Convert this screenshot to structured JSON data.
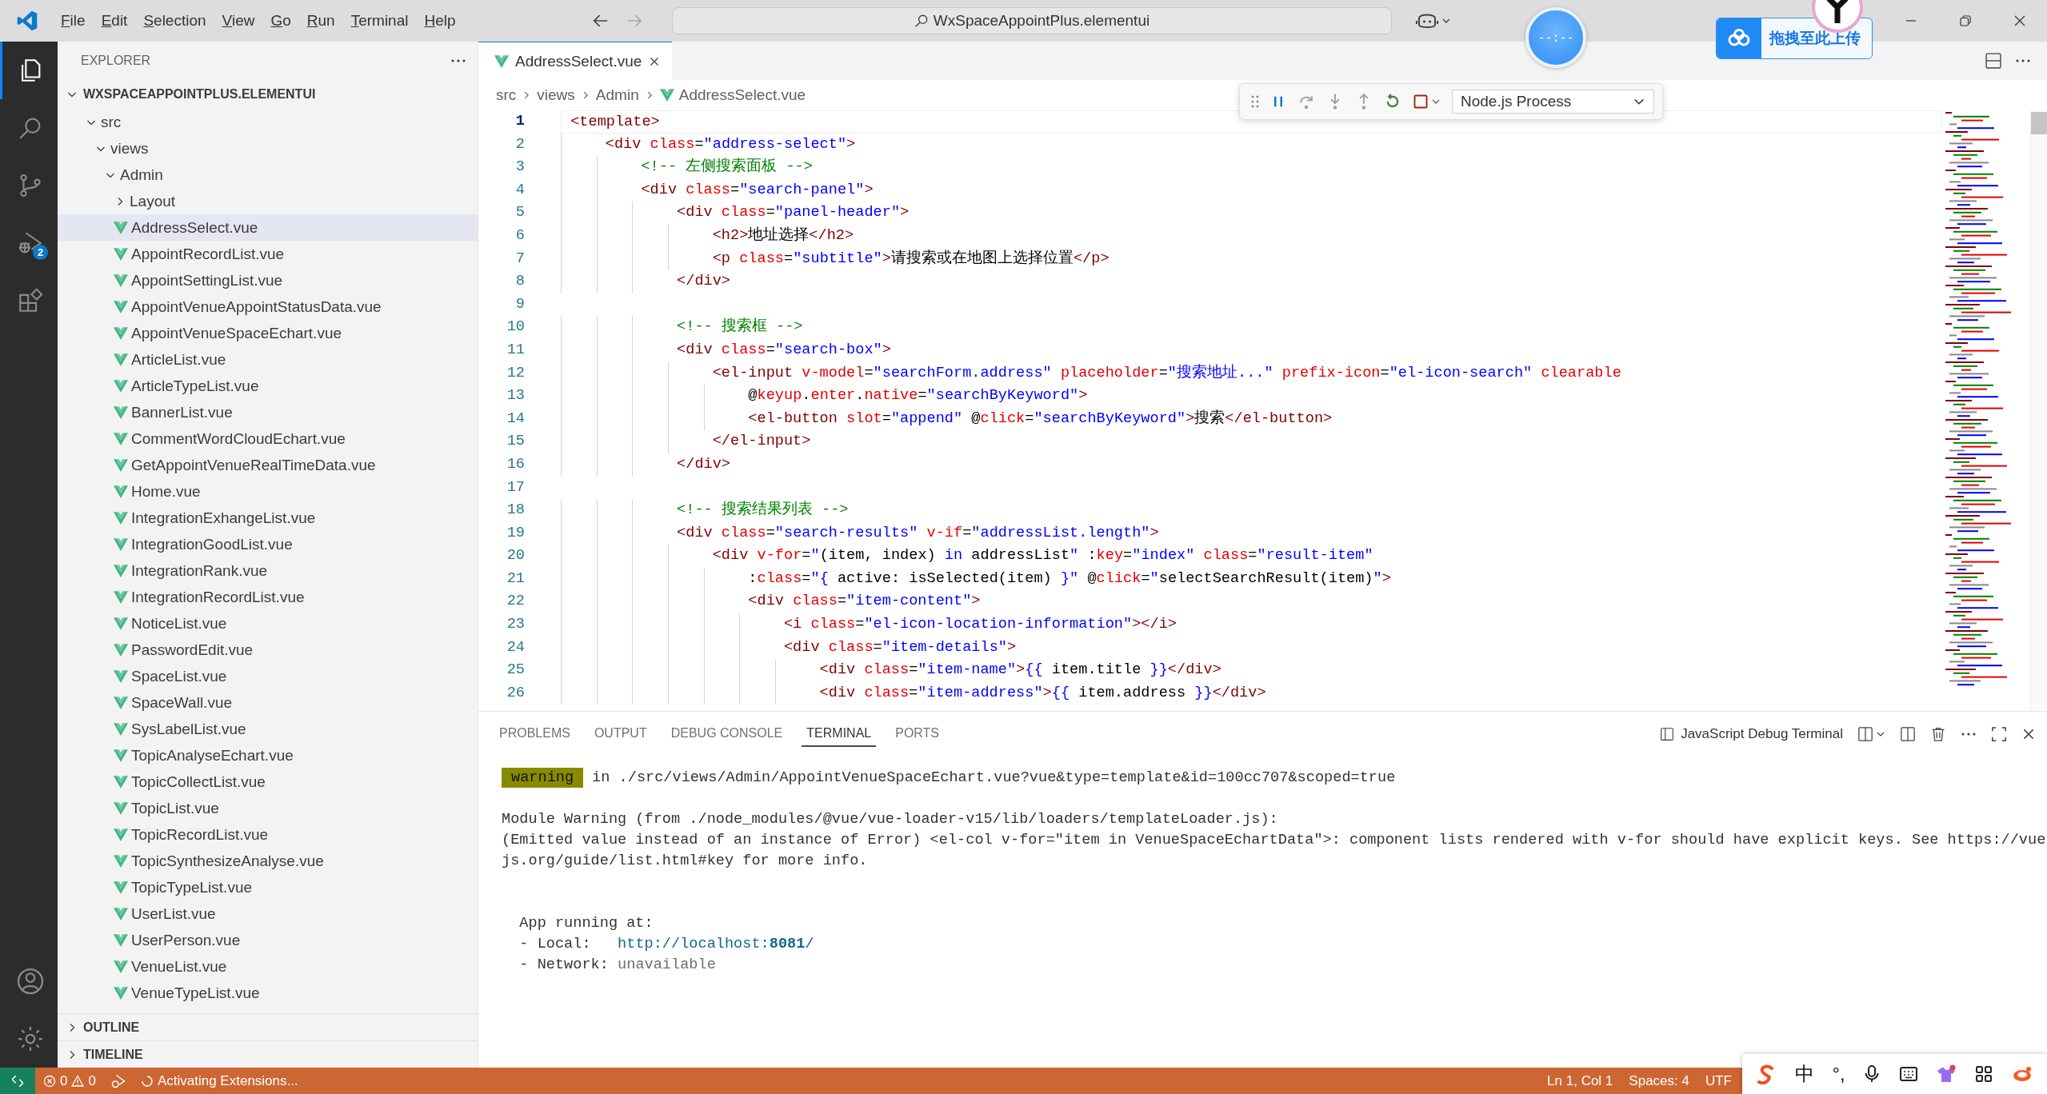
{
  "menu": [
    "File",
    "Edit",
    "Selection",
    "View",
    "Go",
    "Run",
    "Terminal",
    "Help"
  ],
  "command_center": {
    "text": "WxSpaceAppointPlus.elementui"
  },
  "timer_widget": {
    "text": "--:--"
  },
  "upload_widget": {
    "label": "拖拽至此上传"
  },
  "activity_bar": [
    {
      "kind": "explorer",
      "selected": true
    },
    {
      "kind": "search",
      "selected": false
    },
    {
      "kind": "source-control",
      "selected": false
    },
    {
      "kind": "run-debug",
      "selected": false,
      "badge": "2"
    },
    {
      "kind": "extensions",
      "selected": false
    }
  ],
  "activity_bar_bottom": [
    {
      "kind": "account"
    },
    {
      "kind": "manage"
    }
  ],
  "sidebar": {
    "title": "EXPLORER",
    "section": {
      "title": "WXSPACEAPPOINTPLUS.ELEMENTUI",
      "expanded": true
    },
    "tree": [
      {
        "label": "src",
        "kind": "folder",
        "expanded": true,
        "selected": false,
        "children": [
          {
            "label": "views",
            "kind": "folder",
            "expanded": true,
            "selected": false,
            "children": [
              {
                "label": "Admin",
                "kind": "folder",
                "expanded": true,
                "selected": false,
                "children": [
                  {
                    "label": "Layout",
                    "kind": "folder",
                    "expanded": false,
                    "selected": false
                  },
                  {
                    "label": "AddressSelect.vue",
                    "kind": "file",
                    "selected": true
                  },
                  {
                    "label": "AppointRecordList.vue",
                    "kind": "file",
                    "selected": false
                  },
                  {
                    "label": "AppointSettingList.vue",
                    "kind": "file",
                    "selected": false
                  },
                  {
                    "label": "AppointVenueAppointStatusData.vue",
                    "kind": "file",
                    "selected": false
                  },
                  {
                    "label": "AppointVenueSpaceEchart.vue",
                    "kind": "file",
                    "selected": false
                  },
                  {
                    "label": "ArticleList.vue",
                    "kind": "file",
                    "selected": false
                  },
                  {
                    "label": "ArticleTypeList.vue",
                    "kind": "file",
                    "selected": false
                  },
                  {
                    "label": "BannerList.vue",
                    "kind": "file",
                    "selected": false
                  },
                  {
                    "label": "CommentWordCloudEchart.vue",
                    "kind": "file",
                    "selected": false
                  },
                  {
                    "label": "GetAppointVenueRealTimeData.vue",
                    "kind": "file",
                    "selected": false
                  },
                  {
                    "label": "Home.vue",
                    "kind": "file",
                    "selected": false
                  },
                  {
                    "label": "IntegrationExhangeList.vue",
                    "kind": "file",
                    "selected": false
                  },
                  {
                    "label": "IntegrationGoodList.vue",
                    "kind": "file",
                    "selected": false
                  },
                  {
                    "label": "IntegrationRank.vue",
                    "kind": "file",
                    "selected": false
                  },
                  {
                    "label": "IntegrationRecordList.vue",
                    "kind": "file",
                    "selected": false
                  },
                  {
                    "label": "NoticeList.vue",
                    "kind": "file",
                    "selected": false
                  },
                  {
                    "label": "PasswordEdit.vue",
                    "kind": "file",
                    "selected": false
                  },
                  {
                    "label": "SpaceList.vue",
                    "kind": "file",
                    "selected": false
                  },
                  {
                    "label": "SpaceWall.vue",
                    "kind": "file",
                    "selected": false
                  },
                  {
                    "label": "SysLabelList.vue",
                    "kind": "file",
                    "selected": false
                  },
                  {
                    "label": "TopicAnalyseEchart.vue",
                    "kind": "file",
                    "selected": false
                  },
                  {
                    "label": "TopicCollectList.vue",
                    "kind": "file",
                    "selected": false
                  },
                  {
                    "label": "TopicList.vue",
                    "kind": "file",
                    "selected": false
                  },
                  {
                    "label": "TopicRecordList.vue",
                    "kind": "file",
                    "selected": false
                  },
                  {
                    "label": "TopicSynthesizeAnalyse.vue",
                    "kind": "file",
                    "selected": false
                  },
                  {
                    "label": "TopicTypeList.vue",
                    "kind": "file",
                    "selected": false
                  },
                  {
                    "label": "UserList.vue",
                    "kind": "file",
                    "selected": false
                  },
                  {
                    "label": "UserPerson.vue",
                    "kind": "file",
                    "selected": false
                  },
                  {
                    "label": "VenueList.vue",
                    "kind": "file",
                    "selected": false
                  },
                  {
                    "label": "VenueTypeList.vue",
                    "kind": "file",
                    "selected": false
                  }
                ]
              }
            ]
          }
        ]
      }
    ],
    "collapsed_sections": [
      {
        "title": "OUTLINE",
        "expanded": false
      },
      {
        "title": "TIMELINE",
        "expanded": false
      }
    ]
  },
  "editor": {
    "tabs": [
      {
        "label": "AddressSelect.vue",
        "selected": true
      }
    ],
    "breadcrumb": [
      "src",
      "views",
      "Admin",
      "AddressSelect.vue"
    ],
    "lines": [
      {
        "number": "1",
        "tokens": [
          {
            "kind": "tag",
            "text": "<template>"
          }
        ]
      },
      {
        "number": "2",
        "tokens": [
          {
            "kind": "tag",
            "text": "    <div"
          },
          {
            "kind": "attr",
            "text": " class"
          },
          {
            "kind": "text",
            "text": "="
          },
          {
            "kind": "string",
            "text": "\"address-select\""
          },
          {
            "kind": "tag",
            "text": ">"
          }
        ]
      },
      {
        "number": "3",
        "tokens": [
          {
            "kind": "comment",
            "text": "        <!-- 左侧搜索面板 -->"
          }
        ]
      },
      {
        "number": "4",
        "tokens": [
          {
            "kind": "tag",
            "text": "        <div"
          },
          {
            "kind": "attr",
            "text": " class"
          },
          {
            "kind": "text",
            "text": "="
          },
          {
            "kind": "string",
            "text": "\"search-panel\""
          },
          {
            "kind": "tag",
            "text": ">"
          }
        ]
      },
      {
        "number": "5",
        "tokens": [
          {
            "kind": "tag",
            "text": "            <div"
          },
          {
            "kind": "attr",
            "text": " class"
          },
          {
            "kind": "text",
            "text": "="
          },
          {
            "kind": "string",
            "text": "\"panel-header\""
          },
          {
            "kind": "tag",
            "text": ">"
          }
        ]
      },
      {
        "number": "6",
        "tokens": [
          {
            "kind": "tag",
            "text": "                <h2>"
          },
          {
            "kind": "text",
            "text": "地址选择"
          },
          {
            "kind": "tag",
            "text": "</h2>"
          }
        ]
      },
      {
        "number": "7",
        "tokens": [
          {
            "kind": "tag",
            "text": "                <p"
          },
          {
            "kind": "attr",
            "text": " class"
          },
          {
            "kind": "text",
            "text": "="
          },
          {
            "kind": "string",
            "text": "\"subtitle\""
          },
          {
            "kind": "tag",
            "text": ">"
          },
          {
            "kind": "text",
            "text": "请搜索或在地图上选择位置"
          },
          {
            "kind": "tag",
            "text": "</p>"
          }
        ]
      },
      {
        "number": "8",
        "tokens": [
          {
            "kind": "tag",
            "text": "            </div>"
          }
        ]
      },
      {
        "number": "9"
      },
      {
        "number": "10",
        "tokens": [
          {
            "kind": "comment",
            "text": "            <!-- 搜索框 -->"
          }
        ]
      },
      {
        "number": "11",
        "tokens": [
          {
            "kind": "tag",
            "text": "            <div"
          },
          {
            "kind": "attr",
            "text": " class"
          },
          {
            "kind": "text",
            "text": "="
          },
          {
            "kind": "string",
            "text": "\"search-box\""
          },
          {
            "kind": "tag",
            "text": ">"
          }
        ]
      },
      {
        "number": "12",
        "tokens": [
          {
            "kind": "tag",
            "text": "                <el-input"
          },
          {
            "kind": "attr",
            "text": " v-model"
          },
          {
            "kind": "text",
            "text": "="
          },
          {
            "kind": "string",
            "text": "\"searchForm.address\""
          },
          {
            "kind": "attr",
            "text": " placeholder"
          },
          {
            "kind": "text",
            "text": "="
          },
          {
            "kind": "string",
            "text": "\"搜索地址...\""
          },
          {
            "kind": "attr",
            "text": " prefix-icon"
          },
          {
            "kind": "text",
            "text": "="
          },
          {
            "kind": "string",
            "text": "\"el-icon-search\""
          },
          {
            "kind": "attr",
            "text": " clearable"
          }
        ]
      },
      {
        "number": "13",
        "tokens": [
          {
            "kind": "text",
            "text": "                    @"
          },
          {
            "kind": "attr",
            "text": "keyup"
          },
          {
            "kind": "text",
            "text": "."
          },
          {
            "kind": "attr",
            "text": "enter"
          },
          {
            "kind": "text",
            "text": "."
          },
          {
            "kind": "attr",
            "text": "native"
          },
          {
            "kind": "text",
            "text": "="
          },
          {
            "kind": "string",
            "text": "\"searchByKeyword\""
          },
          {
            "kind": "tag",
            "text": ">"
          }
        ]
      },
      {
        "number": "14",
        "tokens": [
          {
            "kind": "tag",
            "text": "                    <el-button"
          },
          {
            "kind": "attr",
            "text": " slot"
          },
          {
            "kind": "text",
            "text": "="
          },
          {
            "kind": "string",
            "text": "\"append\""
          },
          {
            "kind": "text",
            "text": " @"
          },
          {
            "kind": "attr",
            "text": "click"
          },
          {
            "kind": "text",
            "text": "="
          },
          {
            "kind": "string",
            "text": "\"searchByKeyword\""
          },
          {
            "kind": "tag",
            "text": ">"
          },
          {
            "kind": "text",
            "text": "搜索"
          },
          {
            "kind": "tag",
            "text": "</el-button>"
          }
        ]
      },
      {
        "number": "15",
        "tokens": [
          {
            "kind": "tag",
            "text": "                </el-input>"
          }
        ]
      },
      {
        "number": "16",
        "tokens": [
          {
            "kind": "tag",
            "text": "            </div>"
          }
        ]
      },
      {
        "number": "17"
      },
      {
        "number": "18",
        "tokens": [
          {
            "kind": "comment",
            "text": "            <!-- 搜索结果列表 -->"
          }
        ]
      },
      {
        "number": "19",
        "tokens": [
          {
            "kind": "tag",
            "text": "            <div"
          },
          {
            "kind": "attr",
            "text": " class"
          },
          {
            "kind": "text",
            "text": "="
          },
          {
            "kind": "string",
            "text": "\"search-results\""
          },
          {
            "kind": "attr",
            "text": " v-if"
          },
          {
            "kind": "text",
            "text": "="
          },
          {
            "kind": "string",
            "text": "\"addressList.length\""
          },
          {
            "kind": "tag",
            "text": ">"
          }
        ]
      },
      {
        "number": "20",
        "tokens": [
          {
            "kind": "tag",
            "text": "                <div"
          },
          {
            "kind": "attr",
            "text": " v-for"
          },
          {
            "kind": "text",
            "text": "="
          },
          {
            "kind": "string",
            "text": "\""
          },
          {
            "kind": "text",
            "text": "(item, index) "
          },
          {
            "kind": "string",
            "text": "in"
          },
          {
            "kind": "text",
            "text": " addressList"
          },
          {
            "kind": "string",
            "text": "\""
          },
          {
            "kind": "text",
            "text": " :"
          },
          {
            "kind": "attr",
            "text": "key"
          },
          {
            "kind": "text",
            "text": "="
          },
          {
            "kind": "string",
            "text": "\"index\""
          },
          {
            "kind": "attr",
            "text": " class"
          },
          {
            "kind": "text",
            "text": "="
          },
          {
            "kind": "string",
            "text": "\"result-item\""
          }
        ]
      },
      {
        "number": "21",
        "tokens": [
          {
            "kind": "text",
            "text": "                    :"
          },
          {
            "kind": "attr",
            "text": "class"
          },
          {
            "kind": "text",
            "text": "="
          },
          {
            "kind": "string",
            "text": "\"{"
          },
          {
            "kind": "text",
            "text": " active: isSelected(item) "
          },
          {
            "kind": "string",
            "text": "}\""
          },
          {
            "kind": "text",
            "text": " @"
          },
          {
            "kind": "attr",
            "text": "click"
          },
          {
            "kind": "text",
            "text": "="
          },
          {
            "kind": "string",
            "text": "\""
          },
          {
            "kind": "text",
            "text": "selectSearchResult(item)"
          },
          {
            "kind": "string",
            "text": "\""
          },
          {
            "kind": "tag",
            "text": ">"
          }
        ]
      },
      {
        "number": "22",
        "tokens": [
          {
            "kind": "tag",
            "text": "                    <div"
          },
          {
            "kind": "attr",
            "text": " class"
          },
          {
            "kind": "text",
            "text": "="
          },
          {
            "kind": "string",
            "text": "\"item-content\""
          },
          {
            "kind": "tag",
            "text": ">"
          }
        ]
      },
      {
        "number": "23",
        "tokens": [
          {
            "kind": "tag",
            "text": "                        <i"
          },
          {
            "kind": "attr",
            "text": " class"
          },
          {
            "kind": "text",
            "text": "="
          },
          {
            "kind": "string",
            "text": "\"el-icon-location-information\""
          },
          {
            "kind": "tag",
            "text": "></i>"
          }
        ]
      },
      {
        "number": "24",
        "tokens": [
          {
            "kind": "tag",
            "text": "                        <div"
          },
          {
            "kind": "attr",
            "text": " class"
          },
          {
            "kind": "text",
            "text": "="
          },
          {
            "kind": "string",
            "text": "\"item-details\""
          },
          {
            "kind": "tag",
            "text": ">"
          }
        ]
      },
      {
        "number": "25",
        "tokens": [
          {
            "kind": "tag",
            "text": "                            <div"
          },
          {
            "kind": "attr",
            "text": " class"
          },
          {
            "kind": "text",
            "text": "="
          },
          {
            "kind": "string",
            "text": "\"item-name\""
          },
          {
            "kind": "tag",
            "text": ">"
          },
          {
            "kind": "string",
            "text": "{{"
          },
          {
            "kind": "text",
            "text": " item.title "
          },
          {
            "kind": "string",
            "text": "}}"
          },
          {
            "kind": "tag",
            "text": "</div>"
          }
        ]
      },
      {
        "number": "26",
        "tokens": [
          {
            "kind": "tag",
            "text": "                            <div"
          },
          {
            "kind": "attr",
            "text": " class"
          },
          {
            "kind": "text",
            "text": "="
          },
          {
            "kind": "string",
            "text": "\"item-address\""
          },
          {
            "kind": "tag",
            "text": ">"
          },
          {
            "kind": "string",
            "text": "{{"
          },
          {
            "kind": "text",
            "text": " item.address "
          },
          {
            "kind": "string",
            "text": "}}"
          },
          {
            "kind": "tag",
            "text": "</div>"
          }
        ]
      }
    ]
  },
  "debug_toolbar": {
    "process": "Node.js Process"
  },
  "panel": {
    "tabs": [
      {
        "label": "PROBLEMS",
        "selected": false
      },
      {
        "label": "OUTPUT",
        "selected": false
      },
      {
        "label": "DEBUG CONSOLE",
        "selected": false
      },
      {
        "label": "TERMINAL",
        "selected": true
      },
      {
        "label": "PORTS",
        "selected": false
      }
    ],
    "terminal_name": "JavaScript Debug Terminal",
    "blocks": [
      [
        {
          "parts": [
            {
              "kind": "badge",
              "text": "warning"
            },
            {
              "kind": "text",
              "text": "in ./src/views/Admin/AppointVenueSpaceEchart.vue?vue&type=template&id=100cc707&scoped=true"
            }
          ]
        }
      ],
      [
        {
          "parts": [
            {
              "kind": "text",
              "text": "Module Warning (from ./node_modules/@vue/vue-loader-v15/lib/loaders/templateLoader.js):"
            }
          ]
        },
        {
          "parts": [
            {
              "kind": "text",
              "text": "(Emitted value instead of an instance of Error) <el-col v-for=\"item in VenueSpaceEchartData\">: component lists rendered with v-for should have explicit keys. See https://vue"
            }
          ]
        },
        {
          "parts": [
            {
              "kind": "text",
              "text": "js.org/guide/list.html#key for more info."
            }
          ]
        }
      ],
      [
        {
          "parts": [
            {
              "kind": "text",
              "text": "  App running at:"
            }
          ]
        },
        {
          "parts": [
            {
              "kind": "text",
              "text": "  - Local:   "
            },
            {
              "kind": "link",
              "text": "http://localhost:**8081**/"
            }
          ]
        },
        {
          "parts": [
            {
              "kind": "text",
              "text": "  - Network: "
            },
            {
              "kind": "dim",
              "text": "unavailable"
            }
          ]
        }
      ]
    ]
  },
  "status_bar": {
    "errors": "0",
    "warnings": "0",
    "message": "Activating Extensions...",
    "right": [
      "Ln 1, Col 1",
      "Spaces: 4",
      "UTF"
    ]
  },
  "ime_toolbar": {
    "language": "中",
    "punctuation": "°,"
  }
}
